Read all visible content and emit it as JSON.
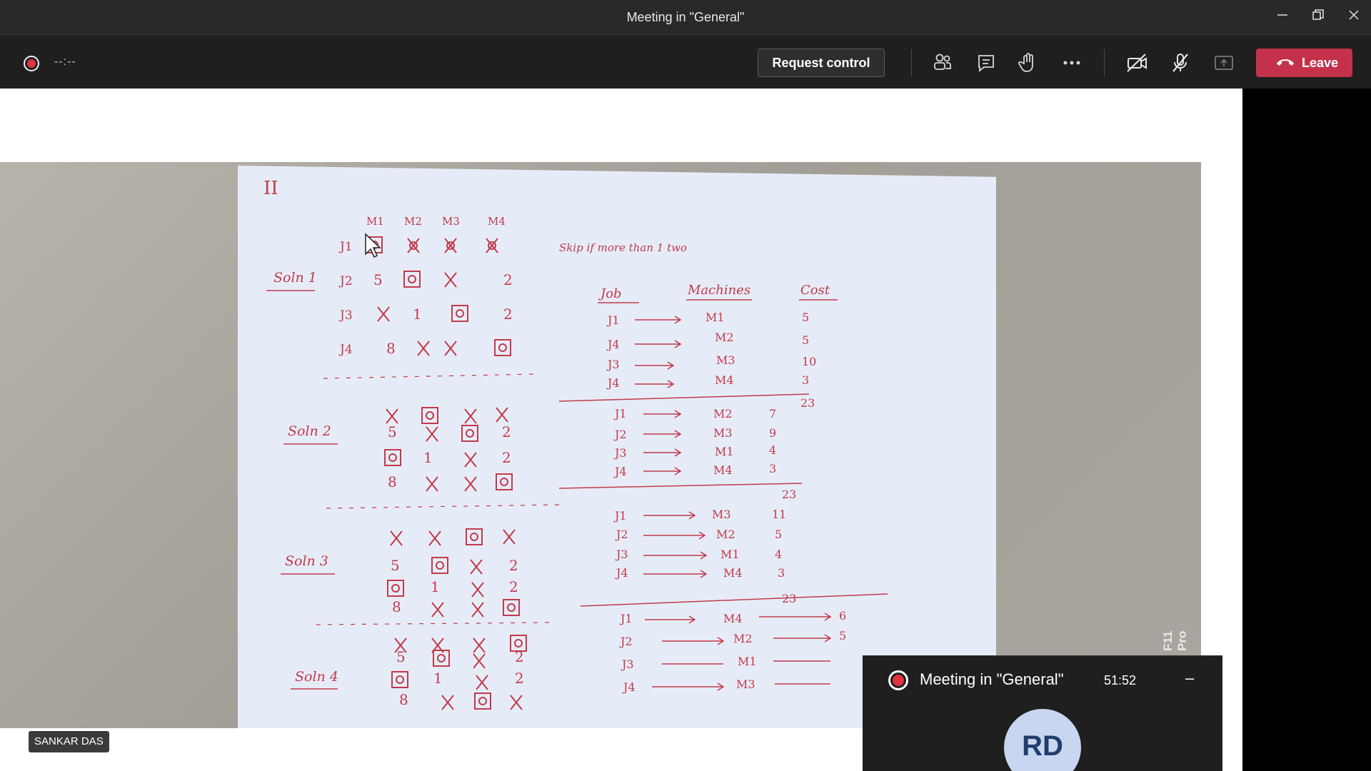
{
  "window": {
    "title": "Meeting in \"General\"",
    "minimize_icon": "minimize-icon",
    "maximize_icon": "restore-icon",
    "close_icon": "close-icon"
  },
  "toolbar": {
    "recording_icon": "record-icon",
    "timer": "--:--",
    "request_control_label": "Request control",
    "icons": [
      "people-icon",
      "chat-icon",
      "raise-hand-icon",
      "more-icon",
      "camera-off-icon",
      "mic-off-icon",
      "share-tray-icon"
    ],
    "leave_label": "Leave",
    "leave_color": "#c4314b"
  },
  "video": {
    "participant_name": "SANKAR DAS",
    "camera_watermark": "F11 Pro"
  },
  "sheet": {
    "heading": "II",
    "note": "Skip if more than 1 two",
    "col_headers": [
      "M1",
      "M2",
      "M3",
      "M4"
    ],
    "row_labels": [
      "J1",
      "J2",
      "J3",
      "J4"
    ],
    "solution_labels": [
      "Soln 1",
      "Soln 2",
      "Soln 3",
      "Soln 4"
    ],
    "table_headers": [
      "Job",
      "Machines",
      "Cost"
    ],
    "sol1_rows": [
      [
        "J1",
        "M1",
        "5"
      ],
      [
        "J4",
        "M2",
        "5"
      ],
      [
        "J3",
        "M3",
        "10"
      ],
      [
        "J4",
        "M4",
        "3"
      ]
    ],
    "sol1_total": "23",
    "sol2_rows": [
      [
        "J1",
        "M2",
        "7"
      ],
      [
        "J2",
        "M3",
        "9"
      ],
      [
        "J3",
        "M1",
        "4"
      ],
      [
        "J4",
        "M4",
        "3"
      ]
    ],
    "sol2_total": "23",
    "sol3_rows": [
      [
        "J1",
        "M3",
        "11"
      ],
      [
        "J2",
        "M2",
        "5"
      ],
      [
        "J3",
        "M1",
        "4"
      ],
      [
        "J4",
        "M4",
        "3"
      ]
    ],
    "sol3_total": "23",
    "sol4_rows": [
      [
        "J1",
        "M4",
        "6"
      ],
      [
        "J2",
        "M2",
        "5"
      ],
      [
        "J3",
        "M1",
        ""
      ],
      [
        "J4",
        "M3",
        ""
      ]
    ]
  },
  "mini_window": {
    "title": "Meeting in \"General\"",
    "time": "51:52",
    "minimize_label": "–",
    "avatar_initials": "RD"
  }
}
